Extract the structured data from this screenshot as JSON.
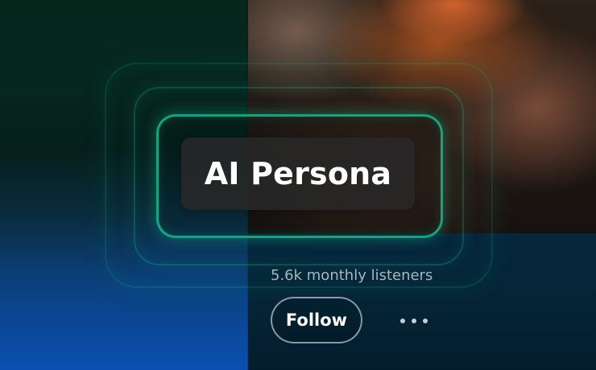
{
  "artist": {
    "name": "AI Persona",
    "monthly_listeners": "5.6k monthly listeners"
  },
  "actions": {
    "follow_label": "Follow",
    "more_icon": "more-horizontal-icon"
  },
  "colors": {
    "accent": "#16C292",
    "left_top": "#07261C",
    "left_bottom": "#0A4FB2",
    "navy": "#052638"
  }
}
